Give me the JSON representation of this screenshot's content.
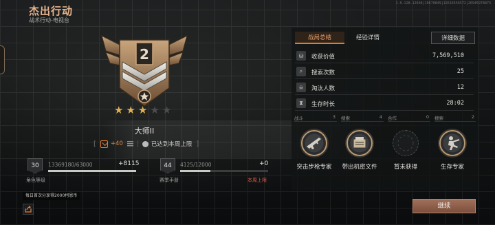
{
  "header": {
    "title": "杰出行动",
    "subtitle": "战术行动-电视台",
    "version": "1.0.128.12696|10670849|12616556572|26945978873"
  },
  "rank": {
    "stars_total": 5,
    "stars_earned": 3,
    "name": "大师II",
    "points_delta": "+40",
    "weekly_cap_label": "已达到本周上限"
  },
  "character_level": {
    "level": "30",
    "progress": "13369180/63000",
    "delta": "+8115",
    "fill_fraction": 1.0,
    "label": "角色等级"
  },
  "season_manual": {
    "level": "44",
    "progress": "4125/12000",
    "delta": "+0",
    "fill_fraction": 0.34,
    "label": "赛季手册",
    "note": "本周上限"
  },
  "notice": "每日首次分享得2000柯恩币",
  "tabs": {
    "summary": "战局总结",
    "experience": "经验详情",
    "details": "详细数据"
  },
  "stats": [
    {
      "icon": "loot-icon",
      "label": "收获价值",
      "value": "7,569,510"
    },
    {
      "icon": "search-icon",
      "label": "搜索次数",
      "value": "25"
    },
    {
      "icon": "eliminations-icon",
      "label": "淘汰人数",
      "value": "12"
    },
    {
      "icon": "hourglass-icon",
      "label": "生存时长",
      "value": "28:02"
    }
  ],
  "achievement_categories": [
    {
      "name": "战斗",
      "count": "3"
    },
    {
      "name": "搜索",
      "count": "4"
    },
    {
      "name": "合作",
      "count": "0"
    },
    {
      "name": "搜索",
      "count": "2"
    }
  ],
  "achievements": [
    {
      "label": "突击步枪专家",
      "obtained": true,
      "icon": "assault-rifle-icon"
    },
    {
      "label": "带出机密文件",
      "obtained": true,
      "icon": "classified-file-icon"
    },
    {
      "label": "暂未获得",
      "obtained": false,
      "icon": "empty-medal-icon"
    },
    {
      "label": "生存专家",
      "obtained": true,
      "icon": "survival-soldier-icon"
    }
  ],
  "continue_button": "继续",
  "colors": {
    "accent_orange": "#e07c35",
    "title_peach": "#e9b58e",
    "star_gold": "#e0b055",
    "warning_red": "#d25a4a",
    "button_bronze": "#8e604b"
  }
}
